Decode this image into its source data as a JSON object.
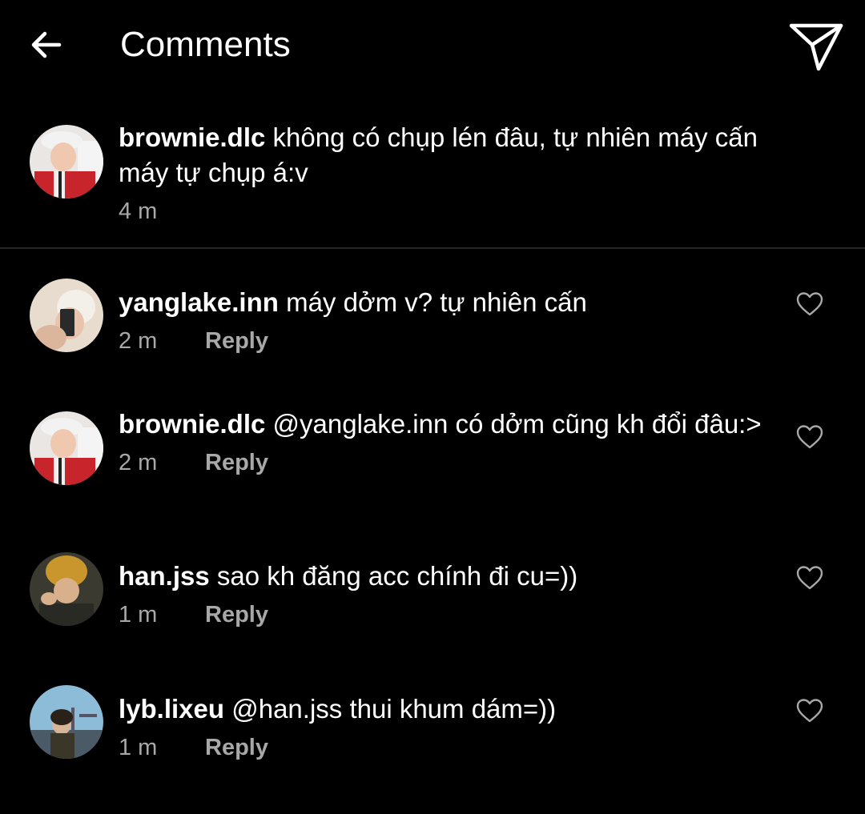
{
  "header": {
    "title": "Comments",
    "back_icon": "arrow-left-icon",
    "send_icon": "paper-plane-icon"
  },
  "caption": {
    "username": "brownie.dlc",
    "text": " không có chụp lén đâu, tự nhiên máy cấn máy tự chụp á:v",
    "time": "4 m"
  },
  "comments": [
    {
      "username": "yanglake.inn",
      "text": " máy dởm v? tự nhiên cấn",
      "time": "2 m",
      "reply": "Reply"
    },
    {
      "username": "brownie.dlc",
      "text": " @yanglake.inn có dởm cũng kh đổi đâu:>",
      "time": "2 m",
      "reply": "Reply"
    },
    {
      "username": "han.jss",
      "text": " sao kh đăng acc chính đi cu=))",
      "time": "1 m",
      "reply": "Reply"
    },
    {
      "username": "lyb.lixeu",
      "text": " @han.jss thui khum dám=))",
      "time": "1 m",
      "reply": "Reply"
    }
  ],
  "colors": {
    "background": "#000000",
    "text": "#ffffff",
    "secondary": "#a8a8a8",
    "divider": "#262626"
  }
}
